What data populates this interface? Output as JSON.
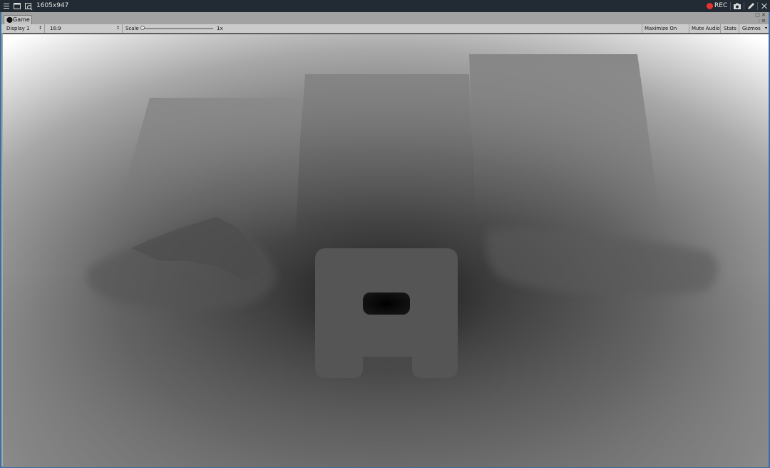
{
  "topbar": {
    "resolution": "1605x947",
    "rec_label": "REC",
    "icons": [
      "menu-icon",
      "window-icon",
      "search-window-icon",
      "camera-icon",
      "pen-icon",
      "close-icon"
    ]
  },
  "editor": {
    "tab_label": "Game",
    "toolbar": {
      "display": "Display 1",
      "aspect": "16:9",
      "scale_label": "Scale",
      "scale_value": "1x",
      "maximize": "Maximize On Play",
      "mute": "Mute Audio",
      "stats": "Stats",
      "gizmos": "Gizmos"
    }
  },
  "colors": {
    "rec": "#e8322f",
    "window_border": "#3a6ea5",
    "topbar_bg": "#222b33"
  }
}
